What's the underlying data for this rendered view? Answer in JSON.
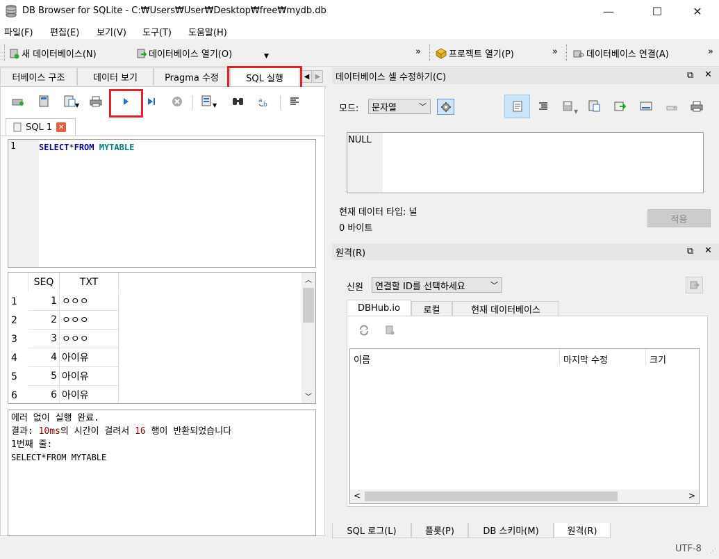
{
  "window": {
    "title": "DB Browser for SQLite - C:₩Users₩User₩Desktop₩free₩mydb.db",
    "minimize": "—",
    "maximize": "☐",
    "close": "✕"
  },
  "menu": {
    "file": "파일(F)",
    "edit": "편집(E)",
    "view": "보기(V)",
    "tools": "도구(T)",
    "help": "도움말(H)"
  },
  "toolbar": {
    "new_db": "새 데이터베이스(N)",
    "open_db": "데이터베이스 열기(O)",
    "open_project": "프로젝트 열기(P)",
    "attach_db": "데이터베이스 연결(A)",
    "overflow": "»"
  },
  "left_tabs": {
    "db_structure": "터베이스 구조",
    "browse_data": "데이터 보기",
    "pragma": "Pragma 수정",
    "execute_sql": "SQL 실행"
  },
  "editor": {
    "tab_label": "SQL 1",
    "line_number": "1",
    "sql_keyword_select": "SELECT",
    "sql_star": "*",
    "sql_keyword_from": "FROM",
    "sql_table": " MYTABLE"
  },
  "results": {
    "columns": [
      "SEQ",
      "TXT"
    ],
    "rows": [
      {
        "n": "1",
        "seq": "1",
        "txt": "ㅇㅇㅇ"
      },
      {
        "n": "2",
        "seq": "2",
        "txt": "ㅇㅇㅇ"
      },
      {
        "n": "3",
        "seq": "3",
        "txt": "ㅇㅇㅇ"
      },
      {
        "n": "4",
        "seq": "4",
        "txt": "아이유"
      },
      {
        "n": "5",
        "seq": "5",
        "txt": "아이유"
      },
      {
        "n": "6",
        "seq": "6",
        "txt": "아이유"
      }
    ]
  },
  "message": {
    "line1": "에러 없이 실행 완료.",
    "line2_a": "결과: ",
    "line2_b": "10ms",
    "line2_c": "의 시간이 걸려서 ",
    "line2_d": "16",
    "line2_e": " 행이 반환되었습니다",
    "line3": "1번째 줄:",
    "line4": "SELECT*FROM MYTABLE"
  },
  "edit_cell": {
    "title": "데이터베이스 셀 수정하기(C)",
    "mode_label": "모드:",
    "mode_value": "문자열",
    "value": "NULL",
    "type_label": "현재 데이터 타입: 널",
    "size_label": "0 바이트",
    "apply": "적용"
  },
  "remote": {
    "title": "원격(R)",
    "identity_label": "신원",
    "identity_value": "연결할 ID를 선택하세요",
    "tabs": [
      "DBHub.io",
      "로컬",
      "현재 데이터베이스"
    ],
    "columns": [
      "이름",
      "마지막 수정",
      "크기"
    ]
  },
  "bottom_tabs": [
    "SQL 로그(L)",
    "플롯(P)",
    "DB 스키마(M)",
    "원격(R)"
  ],
  "status": {
    "encoding": "UTF-8"
  },
  "colors": {
    "highlight": "#e0232b",
    "keyword": "#00008b",
    "table": "#008080",
    "number": "#8b0000"
  }
}
